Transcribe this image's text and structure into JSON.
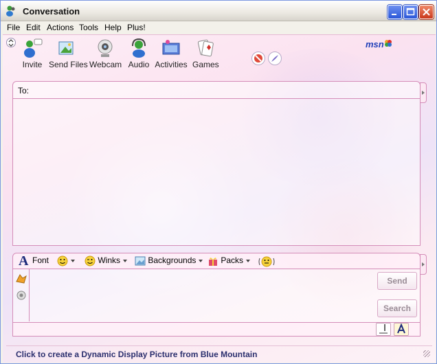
{
  "window": {
    "title": "Conversation"
  },
  "menu": {
    "items": [
      "File",
      "Edit",
      "Actions",
      "Tools",
      "Help",
      "Plus!"
    ]
  },
  "toolbar": {
    "items": [
      {
        "label": "Invite",
        "icon": "invite-icon"
      },
      {
        "label": "Send Files",
        "icon": "send-files-icon"
      },
      {
        "label": "Webcam",
        "icon": "webcam-icon"
      },
      {
        "label": "Audio",
        "icon": "audio-icon"
      },
      {
        "label": "Activities",
        "icon": "activities-icon"
      },
      {
        "label": "Games",
        "icon": "games-icon"
      }
    ],
    "brand": "msn"
  },
  "to_field": {
    "label": "To:"
  },
  "compose_toolbar": {
    "font_label": "Font",
    "winks_label": "Winks",
    "backgrounds_label": "Backgrounds",
    "packs_label": "Packs"
  },
  "compose": {
    "value": "",
    "send_label": "Send",
    "search_label": "Search"
  },
  "status": {
    "text": "Click to create a Dynamic Display Picture from Blue Mountain"
  },
  "colors": {
    "accent": "#d48cb8",
    "title_blue": "#2a56d8",
    "close_red": "#c9381b"
  }
}
